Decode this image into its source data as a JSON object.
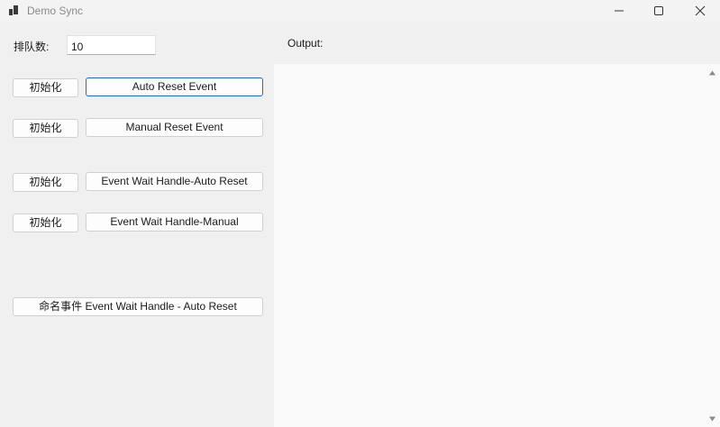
{
  "window": {
    "title": "Demo Sync",
    "icons": {
      "app": "app-icon",
      "minimize": "minimize-icon",
      "maximize": "maximize-icon",
      "close": "close-icon"
    }
  },
  "queue": {
    "label": "排队数:",
    "value": "10"
  },
  "output": {
    "label": "Output:",
    "text": ""
  },
  "rows": [
    {
      "init_label": "初始化",
      "event_label": "Auto Reset Event",
      "focused": true
    },
    {
      "init_label": "初始化",
      "event_label": "Manual Reset Event",
      "focused": false
    },
    {
      "init_label": "初始化",
      "event_label": "Event Wait Handle-Auto Reset",
      "focused": false
    },
    {
      "init_label": "初始化",
      "event_label": "Event Wait Handle-Manual",
      "focused": false
    }
  ],
  "named_event_button": "命名事件 Event Wait Handle - Auto Reset",
  "colors": {
    "focus_border": "#1f6fc0",
    "window_bg": "#f0f0f0",
    "output_bg": "#f9f9f9"
  }
}
